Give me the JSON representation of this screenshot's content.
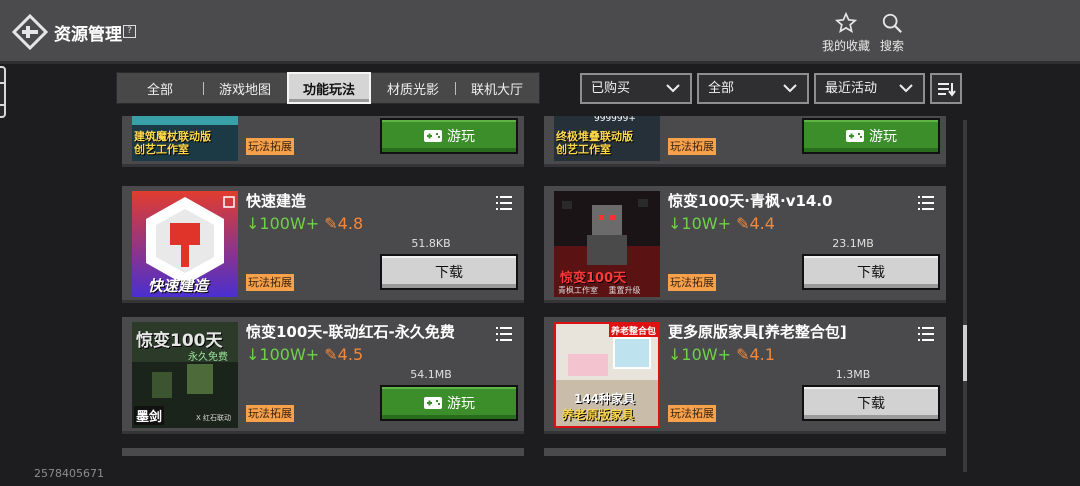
{
  "header": {
    "title": "资源管理",
    "help_symbol": "?",
    "favorites_label": "我的收藏",
    "search_label": "搜索"
  },
  "tabs": [
    {
      "label": "全部",
      "active": false
    },
    {
      "label": "游戏地图",
      "active": false
    },
    {
      "label": "功能玩法",
      "active": true
    },
    {
      "label": "材质光影",
      "active": false
    },
    {
      "label": "联机大厅",
      "active": false
    }
  ],
  "filters": {
    "purchase": "已购买",
    "category": "全部",
    "sort": "最近活动"
  },
  "items": [
    {
      "title": "",
      "downloads": "",
      "rating": "",
      "size": "",
      "tag": "玩法拓展",
      "action": "游玩",
      "action_type": "play",
      "thumb_lines": [
        "建筑魔杖联动版",
        "创艺工作室"
      ]
    },
    {
      "title": "",
      "downloads": "",
      "rating": "",
      "size": "",
      "tag": "玩法拓展",
      "action": "游玩",
      "action_type": "play",
      "thumb_lines": [
        "终极堆叠联动版",
        "创艺工作室"
      ],
      "thumb_top": "999999+"
    },
    {
      "title": "快速建造",
      "downloads": "100W+",
      "rating": "4.8",
      "size": "51.8KB",
      "tag": "玩法拓展",
      "action": "下载",
      "action_type": "download",
      "thumb_lines": [
        "快速建造"
      ]
    },
    {
      "title": "惊变100天·青枫·v14.0",
      "downloads": "10W+",
      "rating": "4.4",
      "size": "23.1MB",
      "tag": "玩法拓展",
      "action": "下载",
      "action_type": "download",
      "thumb_lines": [
        "惊变100天",
        "青枫工作室",
        "重置升级"
      ]
    },
    {
      "title": "惊变100天-联动红石-永久免费",
      "downloads": "100W+",
      "rating": "4.5",
      "size": "54.1MB",
      "tag": "玩法拓展",
      "action": "游玩",
      "action_type": "play",
      "thumb_lines": [
        "惊变100天",
        "永久免费",
        "墨剑",
        "X 红石联动"
      ]
    },
    {
      "title": "更多原版家具[养老整合包]",
      "downloads": "10W+",
      "rating": "4.1",
      "size": "1.3MB",
      "tag": "玩法拓展",
      "action": "下载",
      "action_type": "download",
      "thumb_lines": [
        "养老整合包",
        "144种家具",
        "养老原版家具"
      ]
    }
  ],
  "footer": {
    "uid": "2578405671"
  },
  "colors": {
    "topbar": "#4b4b4d",
    "background": "#1d1d1f",
    "card": "#4a4a4c",
    "play_green": "#3b8e2a",
    "download_gray": "#d2d2d2",
    "downloads_green": "#6fd14a",
    "rating_orange": "#f3883a",
    "tag_orange": "#f7a14b"
  }
}
